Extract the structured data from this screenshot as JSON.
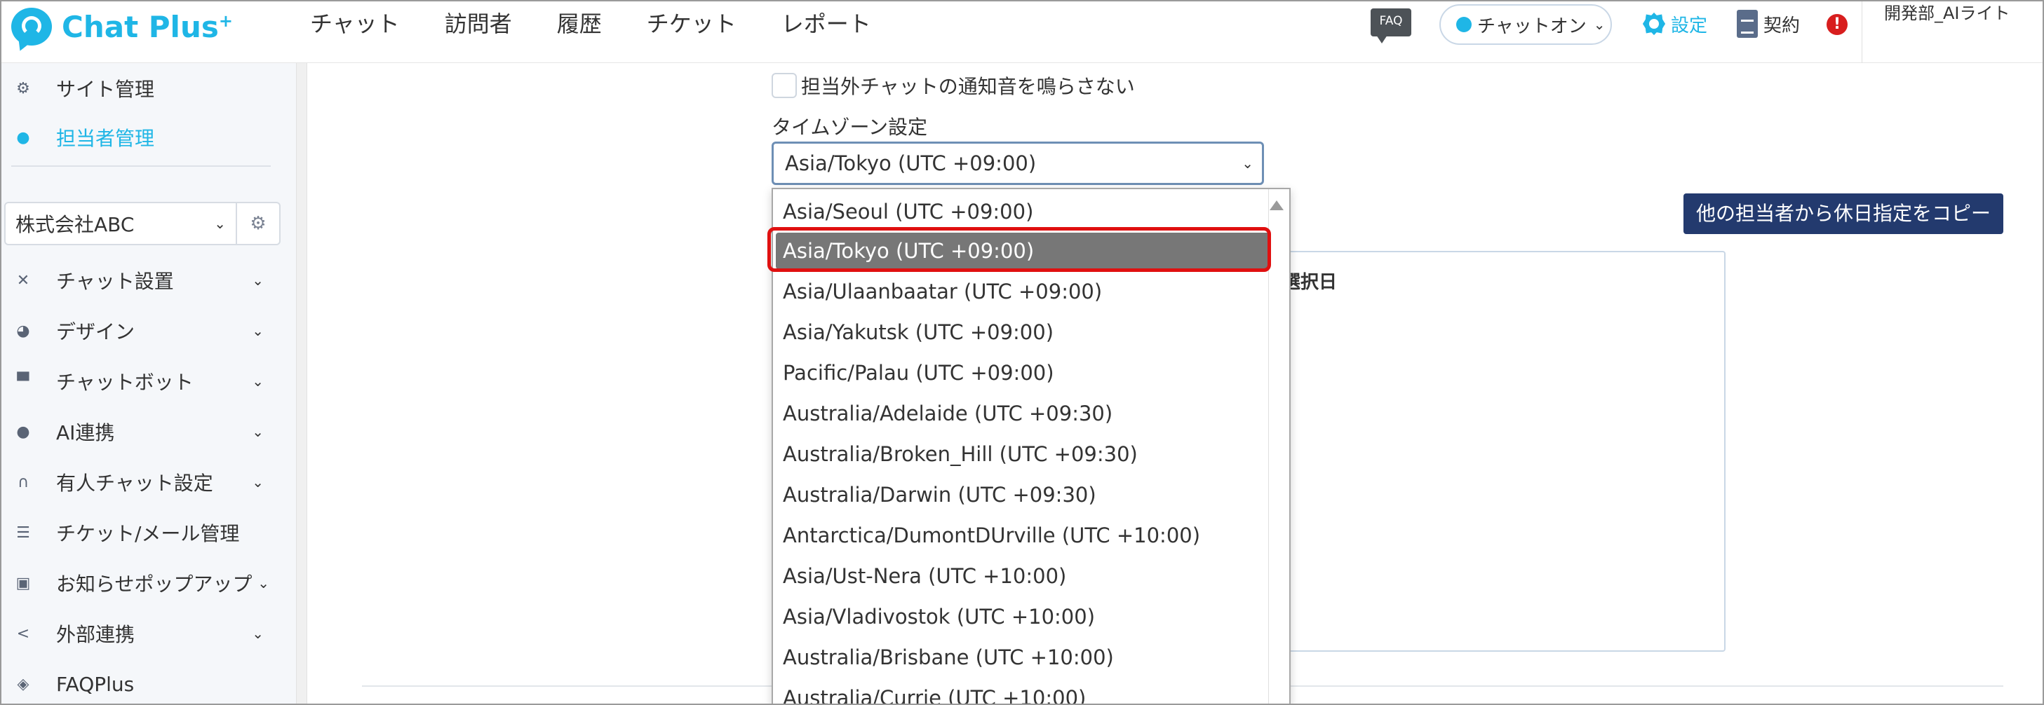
{
  "header": {
    "logo_text": "Chat Plus",
    "logo_sup": "+",
    "nav": [
      "チャット",
      "訪問者",
      "履歴",
      "チケット",
      "レポート"
    ],
    "faq_label": "FAQ",
    "status_label": "チャットオン",
    "settings_label": "設定",
    "contract_label": "契約",
    "alert_mark": "!",
    "user_name": "開発部_AIライト"
  },
  "sidebar": {
    "items_top": [
      {
        "label": "サイト管理",
        "icon": "gear-icon"
      },
      {
        "label": "担当者管理",
        "icon": "user-gear-icon",
        "active": true
      }
    ],
    "company_select": "株式会社ABC",
    "items": [
      {
        "label": "チャット設置",
        "icon": "tools-icon",
        "chevron": true
      },
      {
        "label": "デザイン",
        "icon": "palette-icon",
        "chevron": true
      },
      {
        "label": "チャットボット",
        "icon": "chat-icon",
        "chevron": true
      },
      {
        "label": "AI連携",
        "icon": "brain-icon",
        "chevron": true
      },
      {
        "label": "有人チャット設定",
        "icon": "headset-icon",
        "chevron": true
      },
      {
        "label": "チケット/メール管理",
        "icon": "list-icon",
        "chevron": false
      },
      {
        "label": "お知らせポップアップ",
        "icon": "popup-icon",
        "chevron": true
      },
      {
        "label": "外部連携",
        "icon": "share-icon",
        "chevron": true
      },
      {
        "label": "FAQPlus",
        "icon": "faq-shield-icon",
        "chevron": false
      }
    ]
  },
  "main": {
    "mute_checkbox_label": "担当外チャットの通知音を鳴らさない",
    "timezone_label": "タイムゾーン設定",
    "timezone_value": "Asia/Tokyo (UTC +09:00)",
    "copy_button": "他の担当者から休日指定をコピー",
    "panel_title_fragment": "選択日"
  },
  "dropdown": {
    "options": [
      "Asia/Seoul (UTC +09:00)",
      "Asia/Tokyo (UTC +09:00)",
      "Asia/Ulaanbaatar (UTC +09:00)",
      "Asia/Yakutsk (UTC +09:00)",
      "Pacific/Palau (UTC +09:00)",
      "Australia/Adelaide (UTC +09:30)",
      "Australia/Broken_Hill (UTC +09:30)",
      "Australia/Darwin (UTC +09:30)",
      "Antarctica/DumontDUrville (UTC +10:00)",
      "Asia/Ust-Nera (UTC +10:00)",
      "Asia/Vladivostok (UTC +10:00)",
      "Australia/Brisbane (UTC +10:00)",
      "Australia/Currie (UTC +10:00)"
    ],
    "selected": "Asia/Tokyo (UTC +09:00)",
    "highlight_color": "#e01010"
  },
  "colors": {
    "brand": "#1fb6e6",
    "copy_button_bg": "#233a6e",
    "selected_option_bg": "#777777"
  }
}
